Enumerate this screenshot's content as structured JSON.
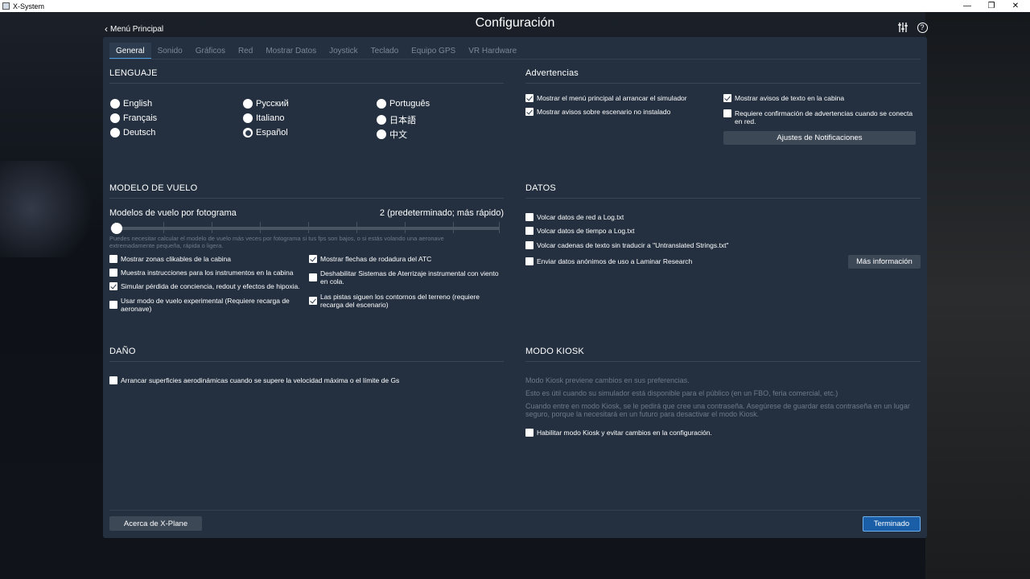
{
  "window": {
    "title": "X-System"
  },
  "header": {
    "title": "Configuración",
    "back_label": "Menú Principal"
  },
  "tabs": [
    {
      "label": "General",
      "active": true
    },
    {
      "label": "Sonido"
    },
    {
      "label": "Gráficos"
    },
    {
      "label": "Red"
    },
    {
      "label": "Mostrar Datos"
    },
    {
      "label": "Joystick"
    },
    {
      "label": "Teclado"
    },
    {
      "label": "Equipo GPS"
    },
    {
      "label": "VR Hardware"
    }
  ],
  "lenguaje": {
    "title": "LENGUAJE",
    "options": [
      {
        "label": "English",
        "selected": false
      },
      {
        "label": "Français",
        "selected": false
      },
      {
        "label": "Deutsch",
        "selected": false
      },
      {
        "label": "Русский",
        "selected": false
      },
      {
        "label": "Italiano",
        "selected": false
      },
      {
        "label": "Español",
        "selected": true
      },
      {
        "label": "Português",
        "selected": false
      },
      {
        "label": "日本語",
        "selected": false
      },
      {
        "label": "中文",
        "selected": false
      }
    ]
  },
  "advertencias": {
    "title": "Advertencias",
    "items": [
      {
        "label": "Mostrar el menú principal al arrancar el simulador",
        "checked": true
      },
      {
        "label": "Mostrar avisos sobre escenario no instalado",
        "checked": true
      },
      {
        "label": "Mostrar avisos de texto en la cabina",
        "checked": true
      },
      {
        "label": "Requiere confirmación de advertencias cuando se conecta en red.",
        "checked": false
      }
    ],
    "notif_button": "Ajustes de Notificaciones"
  },
  "modelo": {
    "title": "MODELO DE VUELO",
    "slider_label": "Modelos de vuelo por fotograma",
    "slider_value_text": "2 (predeterminado; más rápido)",
    "slider_position": 0.0,
    "hint": "Puedes necesitar calcular el modelo de vuelo más veces por fotograma si tus fps son bajos, o si estás volando una aeronave extremadamente pequeña, rápida o ligera.",
    "items_left": [
      {
        "label": "Mostrar zonas clikables de la cabina",
        "checked": false
      },
      {
        "label": "Muestra instrucciones para los instrumentos en la cabina",
        "checked": false
      },
      {
        "label": "Simular pérdida de conciencia, redout y efectos de hipoxia.",
        "checked": true
      },
      {
        "label": "Usar modo de vuelo experimental (Requiere recarga de aeronave)",
        "checked": false
      }
    ],
    "items_right": [
      {
        "label": "Mostrar flechas de rodadura del ATC",
        "checked": true
      },
      {
        "label": "Deshabilitar Sistemas de Aterrizaje instrumental con viento en cola.",
        "checked": false
      },
      {
        "label": "Las pistas siguen los contornos del terreno (requiere recarga del escenario)",
        "checked": true
      }
    ]
  },
  "datos": {
    "title": "DATOS",
    "items": [
      {
        "label": "Volcar datos de red a Log.txt",
        "checked": false
      },
      {
        "label": "Volcar datos de tiempo a Log.txt",
        "checked": false
      },
      {
        "label": "Volcar cadenas de texto sin traducir a \"Untranslated Strings.txt\"",
        "checked": false
      },
      {
        "label": "Enviar datos anónimos de uso a Laminar Research",
        "checked": false
      }
    ],
    "more_button": "Más información"
  },
  "dano": {
    "title": "DAÑO",
    "items": [
      {
        "label": "Arrancar superficies aerodinámicas cuando se supere la velocidad máxima o el límite de Gs",
        "checked": false
      }
    ]
  },
  "kiosk": {
    "title": "MODO KIOSK",
    "p1": "Modo Kiosk previene cambios en sus preferencias.",
    "p2": "Esto es útil cuando su simulador está disponible para el público (en un FBO, feria comercial, etc.)",
    "p3": "Cuando entre en modo Kiosk, se le pedirá que cree una contraseña. Asegúrese de guardar esta contraseña en un lugar seguro, porque la necesitará en un futuro para desactivar el modo Kiosk.",
    "item": {
      "label": "Habilitar modo Kiosk y evitar cambios en la configuración.",
      "checked": false
    }
  },
  "footer": {
    "about_button": "Acerca de X-Plane",
    "done_button": "Terminado"
  },
  "colors": {
    "panel": "#243040",
    "accent": "#1a5ea8",
    "tab_underline": "#4a9ee0"
  }
}
